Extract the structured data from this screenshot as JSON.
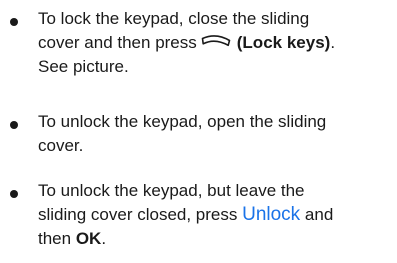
{
  "instructions": [
    {
      "lines": [
        "To lock the keypad, close the sliding",
        "cover and then press",
        "(Lock keys)",
        ".",
        "See picture."
      ],
      "key_icon": "left-selection-key-icon"
    },
    {
      "lines": [
        "To unlock the keypad, open the sliding",
        "cover."
      ]
    },
    {
      "lines": [
        "To unlock the keypad, but leave the",
        "sliding cover closed, press",
        "Unlock",
        "and",
        "then",
        "OK",
        "."
      ]
    }
  ],
  "colors": {
    "text": "#1a1a1a",
    "link": "#1a73e8"
  }
}
